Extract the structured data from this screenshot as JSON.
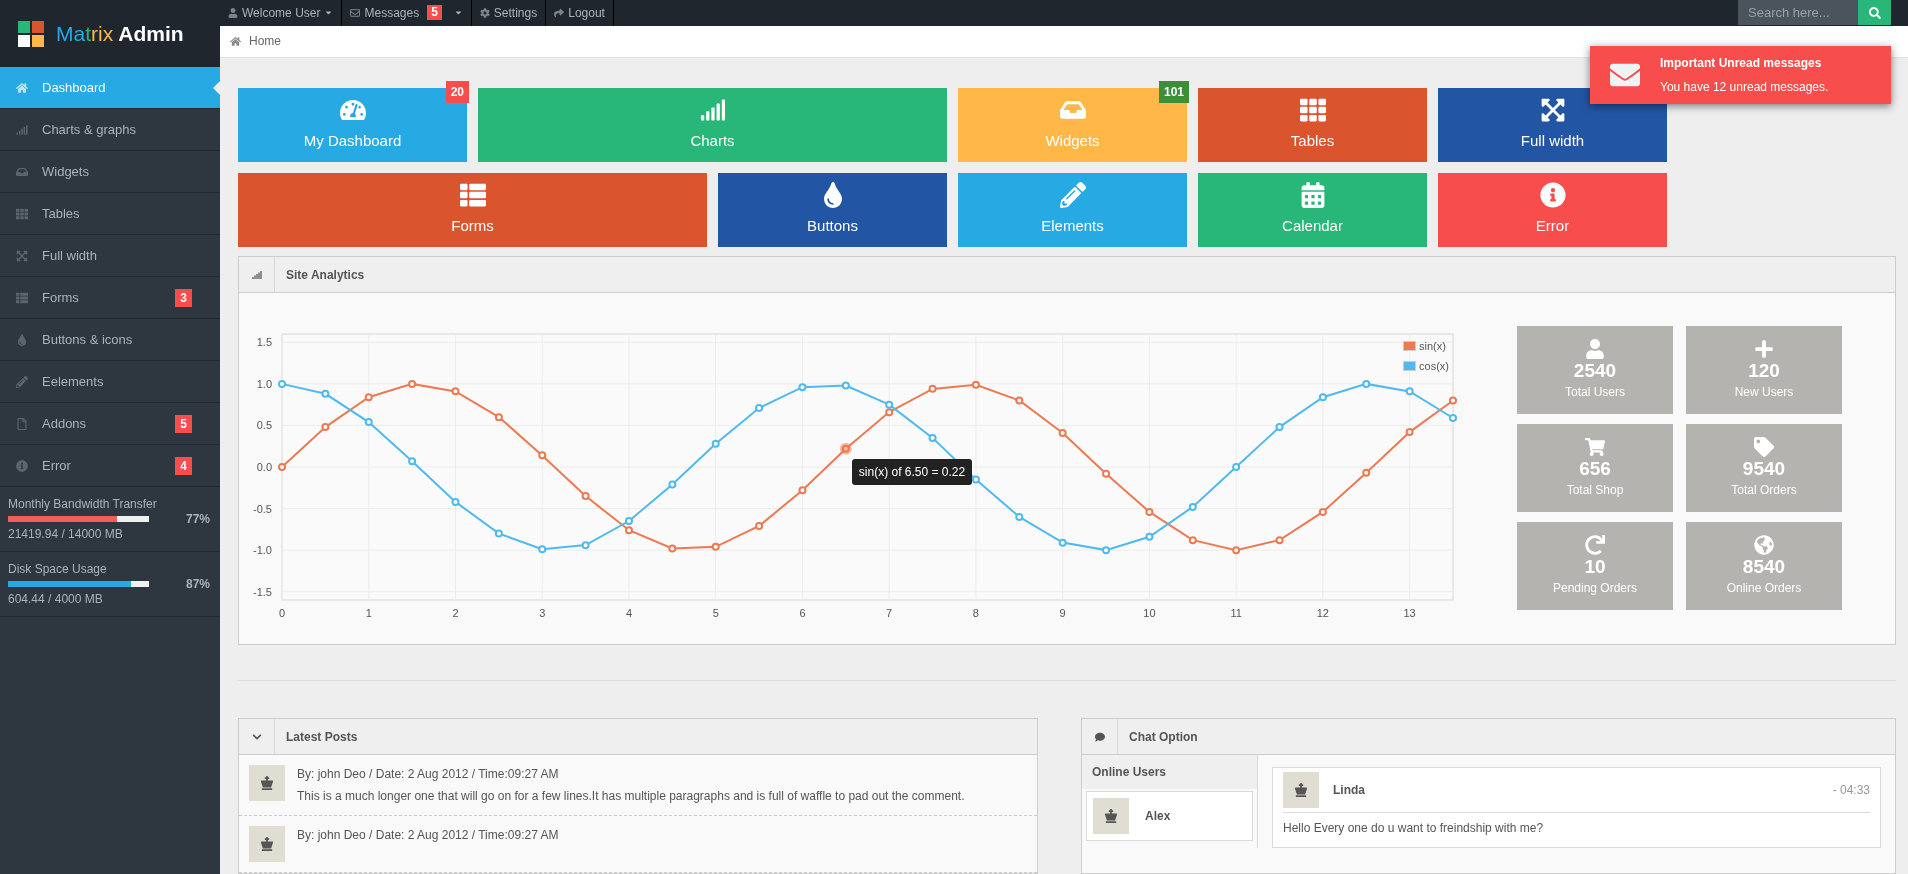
{
  "brand": {
    "segments": [
      {
        "text": "Ma",
        "color": "#27a9e3"
      },
      {
        "text": "t",
        "color": "#28b779"
      },
      {
        "text": "rix",
        "color": "#ffb848"
      }
    ],
    "suffix": "Admin"
  },
  "topbar": {
    "items": [
      {
        "label": "Welcome User",
        "caret": true
      },
      {
        "label": "Messages",
        "badge": "5",
        "caret": true
      },
      {
        "label": "Settings",
        "caret": false
      },
      {
        "label": "Logout",
        "caret": false
      }
    ],
    "search": {
      "placeholder": "Search here..."
    }
  },
  "breadcrumb": [
    "Home"
  ],
  "notification": {
    "title": "Important Unread messages",
    "message": "You have 12 unread messages."
  },
  "sidebar": {
    "items": [
      {
        "label": "Dashboard",
        "selected": true
      },
      {
        "label": "Charts & graphs",
        "selected": false
      },
      {
        "label": "Widgets",
        "selected": false
      },
      {
        "label": "Tables",
        "selected": false
      },
      {
        "label": "Full width",
        "selected": false
      },
      {
        "label": "Forms",
        "selected": false,
        "badge": "3"
      },
      {
        "label": "Buttons & icons",
        "selected": false
      },
      {
        "label": "Eelements",
        "selected": false
      },
      {
        "label": "Addons",
        "selected": false,
        "badge": "5"
      },
      {
        "label": "Error",
        "selected": false,
        "badge": "4"
      }
    ],
    "meters": [
      {
        "label": "Monthly Bandwidth Transfer",
        "level": 0.77,
        "percent": "77%",
        "detail": "21419.94 / 14000 MB",
        "color": "#f0605a"
      },
      {
        "label": "Disk Space Usage",
        "level": 0.87,
        "percent": "87%",
        "detail": "604.44 / 4000 MB",
        "color": "#27a9e3"
      }
    ]
  },
  "quick_links": [
    {
      "label": "My Dashboard",
      "color": "#27a9e3",
      "wide": false,
      "badge": {
        "text": "20",
        "color": "#f74d4d"
      }
    },
    {
      "label": "Charts",
      "color": "#28b779",
      "wide": true
    },
    {
      "label": "Widgets",
      "color": "#ffb848",
      "wide": false,
      "badge": {
        "text": "101",
        "color": "#3c8d3c"
      }
    },
    {
      "label": "Tables",
      "color": "#da542e",
      "wide": false
    },
    {
      "label": "Full width",
      "color": "#2255a4",
      "wide": false
    },
    {
      "label": "Forms",
      "color": "#da542e",
      "wide": true
    },
    {
      "label": "Buttons",
      "color": "#2255a4",
      "wide": false
    },
    {
      "label": "Elements",
      "color": "#27a9e3",
      "wide": false
    },
    {
      "label": "Calendar",
      "color": "#28b779",
      "wide": false
    },
    {
      "label": "Error",
      "color": "#f74d4d",
      "wide": false
    }
  ],
  "analytics": {
    "title": "Site Analytics",
    "chart_data": {
      "type": "line",
      "x": [
        0,
        0.5,
        1,
        1.5,
        2,
        2.5,
        3,
        3.5,
        4,
        4.5,
        5,
        5.5,
        6,
        6.5,
        7,
        7.5,
        8,
        8.5,
        9,
        9.5,
        10,
        10.5,
        11,
        11.5,
        12,
        12.5,
        13,
        13.5
      ],
      "series": [
        {
          "name": "sin(x)",
          "color": "#ee7951",
          "marker": "circle",
          "values": [
            0,
            0.48,
            0.84,
            1.0,
            0.91,
            0.6,
            0.14,
            -0.35,
            -0.76,
            -0.98,
            -0.96,
            -0.71,
            -0.28,
            0.22,
            0.66,
            0.94,
            0.99,
            0.8,
            0.41,
            -0.08,
            -0.54,
            -0.88,
            -1.0,
            -0.88,
            -0.54,
            -0.07,
            0.42,
            0.8
          ]
        },
        {
          "name": "cos(x)",
          "color": "#4fb9f0",
          "marker": "circle",
          "values": [
            1.0,
            0.88,
            0.54,
            0.07,
            -0.42,
            -0.8,
            -0.99,
            -0.94,
            -0.65,
            -0.21,
            0.28,
            0.71,
            0.96,
            0.98,
            0.75,
            0.35,
            -0.15,
            -0.6,
            -0.91,
            -1.0,
            -0.84,
            -0.48,
            0.0,
            0.48,
            0.84,
            1.0,
            0.91,
            0.59
          ]
        }
      ],
      "xlim": [
        0,
        13.5
      ],
      "ylim": [
        -1.6,
        1.6
      ],
      "xticks": [
        0,
        1,
        2,
        3,
        4,
        5,
        6,
        7,
        8,
        9,
        10,
        11,
        12,
        13
      ],
      "yticks": [
        {
          "value": -1.5,
          "label": "-1.5"
        },
        {
          "value": -1,
          "label": "-1.0"
        },
        {
          "value": -0.5,
          "label": "-0.5"
        },
        {
          "value": 0,
          "label": "0.0"
        },
        {
          "value": 0.5,
          "label": "0.5"
        },
        {
          "value": 1,
          "label": "1.0"
        },
        {
          "value": 1.5,
          "label": "1.5"
        }
      ],
      "grid": true,
      "legend": true,
      "annotations": [
        {
          "x": 6.5,
          "y": 0.22,
          "text": "sin(x) of 6.50 = 0.22"
        }
      ]
    },
    "stats": [
      {
        "value": "2540",
        "label": "Total Users"
      },
      {
        "value": "120",
        "label": "New Users"
      },
      {
        "value": "656",
        "label": "Total Shop"
      },
      {
        "value": "9540",
        "label": "Total Orders"
      },
      {
        "value": "10",
        "label": "Pending Orders"
      },
      {
        "value": "8540",
        "label": "Online Orders"
      }
    ]
  },
  "posts": {
    "title": "Latest Posts",
    "items": [
      {
        "meta": "By: john Deo / Date: 2 Aug 2012 / Time:09:27 AM",
        "text": "This is a much longer one that will go on for a few lines.It has multiple paragraphs and is full of waffle to pad out the comment."
      },
      {
        "meta": "By: john Deo / Date: 2 Aug 2012 / Time:09:27 AM"
      }
    ]
  },
  "chat": {
    "title": "Chat Option",
    "online_title": "Online Users",
    "users": [
      {
        "name": "Alex"
      }
    ],
    "messages": [
      {
        "author": "Linda",
        "time": "- 04:33",
        "text": "Hello Every one do u want to freindship with me?"
      }
    ]
  }
}
